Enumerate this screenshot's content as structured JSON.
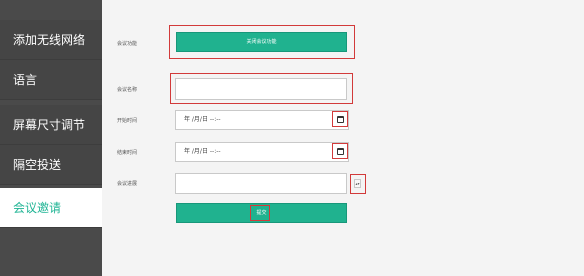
{
  "sidebar": {
    "items": [
      {
        "label": "添加无线网络"
      },
      {
        "label": "语言"
      },
      {
        "label": "屏幕尺寸调节"
      },
      {
        "label": "隔空投送"
      },
      {
        "label": "会议邀请"
      }
    ]
  },
  "form": {
    "meeting_function_label": "会议功能",
    "meeting_function_button": "关闭会议功能",
    "meeting_name_label": "会议名称",
    "meeting_name_value": "",
    "start_time_label": "开始时间",
    "start_time_placeholder": "年 /月/日 --:--",
    "end_time_label": "结束时间",
    "end_time_placeholder": "年 /月/日 --:--",
    "meeting_duration_label": "会议进展",
    "meeting_duration_value": "",
    "submit_label": "提交"
  },
  "icons": {
    "calendar": "calendar-icon",
    "spinner": "number-spinner-icon"
  },
  "colors": {
    "accent": "#20b28f",
    "highlight_box": "#d23a3a",
    "sidebar_bg": "#454545"
  }
}
